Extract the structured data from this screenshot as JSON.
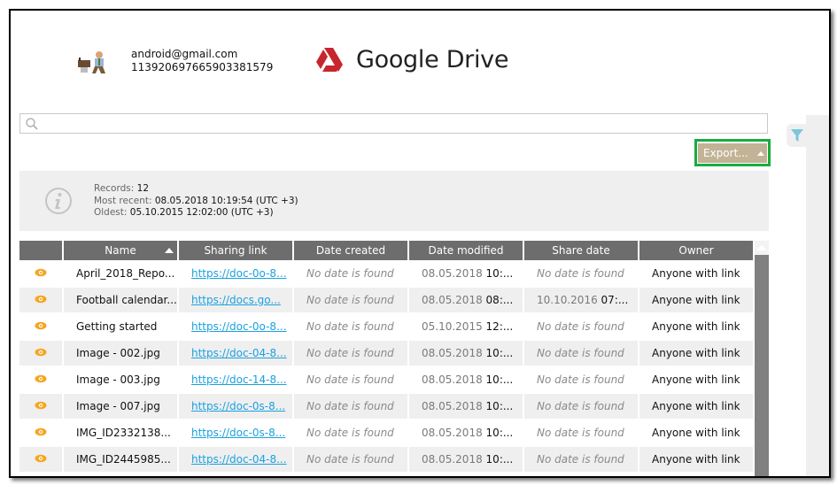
{
  "account": {
    "email": "android@gmail.com",
    "id": "113920697665903381579"
  },
  "brand": {
    "title": "Google Drive",
    "logo_color": "#c8262e"
  },
  "search": {
    "placeholder": "",
    "value": ""
  },
  "toolbar": {
    "export_label": "Export...",
    "export_color": "#c2b396",
    "highlight_color": "#1aab40"
  },
  "info": {
    "records_label": "Records:",
    "records_value": "12",
    "most_recent_label": "Most recent:",
    "most_recent_value": "08.05.2018 10:19:54 (UTC +3)",
    "oldest_label": "Oldest:",
    "oldest_value": "05.10.2015 12:02:00 (UTC +3)"
  },
  "table": {
    "columns": [
      "",
      "Name",
      "Sharing link",
      "Date created",
      "Date modified",
      "Share date",
      "Owner"
    ],
    "sorted_column": "Name",
    "sort_direction": "ascending",
    "no_date_text": "No date is found",
    "rows": [
      {
        "name": "April_2018_Repo...",
        "link": "https://doc-0o-8...",
        "created": "No date is found",
        "modified_date": "08.05.2018",
        "modified_time": "10:...",
        "share_date": "",
        "share_time": "",
        "share_none": "No date is found",
        "owner": "Anyone with link"
      },
      {
        "name": "Football calendar...",
        "link": "https://docs.go...",
        "created": "No date is found",
        "modified_date": "08.05.2018",
        "modified_time": "08:...",
        "share_date": "10.10.2016",
        "share_time": "07:...",
        "share_none": "",
        "owner": "Anyone with link"
      },
      {
        "name": "Getting started",
        "link": "https://doc-0o-8...",
        "created": "No date is found",
        "modified_date": "05.10.2015",
        "modified_time": "12:...",
        "share_date": "",
        "share_time": "",
        "share_none": "No date is found",
        "owner": "Anyone with link"
      },
      {
        "name": "Image - 002.jpg",
        "link": "https://doc-04-8...",
        "created": "No date is found",
        "modified_date": "08.05.2018",
        "modified_time": "10:...",
        "share_date": "",
        "share_time": "",
        "share_none": "No date is found",
        "owner": "Anyone with link"
      },
      {
        "name": "Image - 003.jpg",
        "link": "https://doc-14-8...",
        "created": "No date is found",
        "modified_date": "08.05.2018",
        "modified_time": "10:...",
        "share_date": "",
        "share_time": "",
        "share_none": "No date is found",
        "owner": "Anyone with link"
      },
      {
        "name": "Image - 007.jpg",
        "link": "https://doc-0s-8...",
        "created": "No date is found",
        "modified_date": "08.05.2018",
        "modified_time": "10:...",
        "share_date": "",
        "share_time": "",
        "share_none": "No date is found",
        "owner": "Anyone with link"
      },
      {
        "name": "IMG_ID2332138...",
        "link": "https://doc-0s-8...",
        "created": "No date is found",
        "modified_date": "08.05.2018",
        "modified_time": "10:...",
        "share_date": "",
        "share_time": "",
        "share_none": "No date is found",
        "owner": "Anyone with link"
      },
      {
        "name": "IMG_ID2445985...",
        "link": "https://doc-04-8...",
        "created": "No date is found",
        "modified_date": "08.05.2018",
        "modified_time": "10:...",
        "share_date": "",
        "share_time": "",
        "share_none": "No date is found",
        "owner": "Anyone with link"
      }
    ]
  },
  "icons": {
    "row_icon": "eye-icon",
    "row_icon_color": "#f5a623",
    "filter_icon_color": "#7cc6de",
    "info_icon_color": "#c4c4c4"
  }
}
